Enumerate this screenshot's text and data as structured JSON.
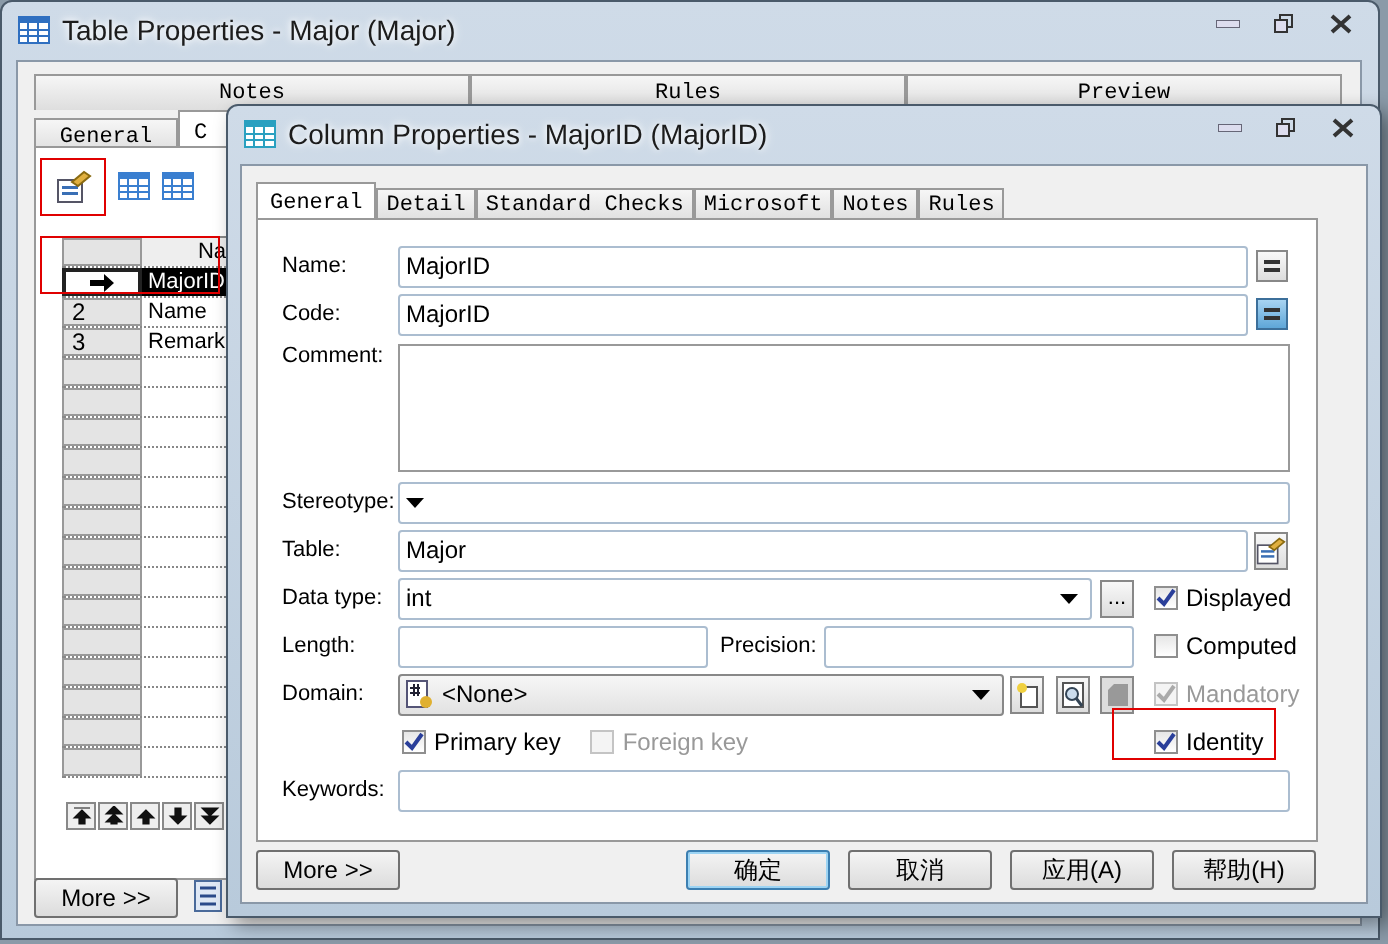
{
  "background_window": {
    "title": "Table Properties - Major (Major)",
    "tabs_row_1": [
      {
        "label": "Notes",
        "selected": false
      },
      {
        "label": "Rules",
        "selected": false
      },
      {
        "label": "Preview",
        "selected": false
      }
    ],
    "tabs_row_2": [
      {
        "label": "General",
        "selected": false
      },
      {
        "label": "C",
        "selected": true
      }
    ],
    "grid": {
      "header": "Na",
      "rows": [
        {
          "name": "MajorID",
          "current": true,
          "selected": true
        },
        {
          "number": "2",
          "name": "Name",
          "current": false,
          "selected": false
        },
        {
          "number": "3",
          "name": "Remark",
          "current": false,
          "selected": false
        }
      ]
    },
    "more_button": "More >>"
  },
  "dialog": {
    "title": "Column Properties - MajorID (MajorID)",
    "tabs": [
      {
        "label": "General",
        "selected": true
      },
      {
        "label": "Detail",
        "selected": false
      },
      {
        "label": "Standard Checks",
        "selected": false
      },
      {
        "label": "Microsoft",
        "selected": false
      },
      {
        "label": "Notes",
        "selected": false
      },
      {
        "label": "Rules",
        "selected": false
      }
    ],
    "name": {
      "label": "Name:",
      "value": "MajorID",
      "equals_pressed": false
    },
    "code": {
      "label": "Code:",
      "value": "MajorID",
      "equals_pressed": true
    },
    "comment": {
      "label": "Comment:"
    },
    "stereotype": {
      "label": "Stereotype:"
    },
    "table": {
      "label": "Table:",
      "value": "Major"
    },
    "data_type": {
      "label": "Data type:",
      "value": "int",
      "browse_button": "..."
    },
    "length": {
      "label": "Length:"
    },
    "precision": {
      "label": "Precision:"
    },
    "domain": {
      "label": "Domain:",
      "value": "<None>"
    },
    "keywords": {
      "label": "Keywords:"
    },
    "checkboxes": [
      {
        "label": "Displayed",
        "checked": true,
        "disabled": false
      },
      {
        "label": "Computed",
        "checked": false,
        "disabled": false
      },
      {
        "label": "Mandatory",
        "checked": true,
        "disabled": true
      },
      {
        "label": "Primary key",
        "checked": true,
        "disabled": false
      },
      {
        "label": "Foreign key",
        "checked": false,
        "disabled": true
      },
      {
        "label": "Identity",
        "checked": true,
        "disabled": false
      }
    ],
    "buttons": [
      {
        "label": "More >>",
        "default": false
      },
      {
        "label": "确定",
        "default": true
      },
      {
        "label": "取消",
        "default": false
      },
      {
        "label": "应用(A)",
        "default": false
      },
      {
        "label": "帮助(H)",
        "default": false
      }
    ]
  }
}
